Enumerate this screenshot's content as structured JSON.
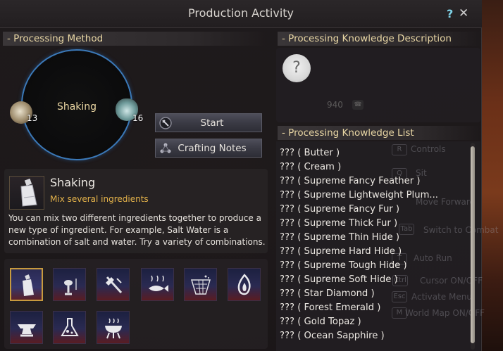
{
  "window": {
    "title": "Production Activity",
    "help": "?",
    "close": "✕"
  },
  "method_section": {
    "header": "- Processing Method",
    "circle_label": "Shaking",
    "ingredient_left_count": "13",
    "ingredient_right_count": "16",
    "start_label": "Start",
    "notes_label": "Crafting Notes"
  },
  "method_info": {
    "name": "Shaking",
    "subtitle": "Mix several ingredients",
    "description": "You can mix two different ingredients together to produce a new type of ingredient. For example, Salt Water is a combination of salt and water. Try a variety of combinations."
  },
  "tools": [
    {
      "name": "shaking",
      "icon": "bottle-icon",
      "selected": true
    },
    {
      "name": "grinding",
      "icon": "mortar-icon",
      "selected": false
    },
    {
      "name": "chopping",
      "icon": "axe-icon",
      "selected": false
    },
    {
      "name": "drying",
      "icon": "fish-icon",
      "selected": false
    },
    {
      "name": "filtering",
      "icon": "net-icon",
      "selected": false
    },
    {
      "name": "heating",
      "icon": "flame-icon",
      "selected": false
    },
    {
      "name": "smithing",
      "icon": "anvil-icon",
      "selected": false
    },
    {
      "name": "alchemy",
      "icon": "flask-icon",
      "selected": false
    },
    {
      "name": "cooking",
      "icon": "grill-icon",
      "selected": false
    }
  ],
  "knowledge_description": {
    "header": "- Processing Knowledge Description",
    "placeholder_icon": "?",
    "value": "940"
  },
  "knowledge_list": {
    "header": "- Processing Knowledge List",
    "items": [
      "??? ( Butter )",
      "??? ( Cream )",
      "??? ( Supreme Fancy Feather )",
      "??? ( Supreme Lightweight Plum...",
      "??? ( Supreme Fancy Fur )",
      "??? ( Supreme Thick Fur )",
      "??? ( Supreme Thin Hide )",
      "??? ( Supreme Hard Hide )",
      "??? ( Supreme Tough Hide )",
      "??? ( Supreme Soft Hide )",
      "??? ( Star Diamond )",
      "??? ( Forest Emerald )",
      "??? ( Gold Topaz )",
      "??? ( Ocean Sapphire )"
    ]
  },
  "overlay_hints": [
    {
      "key": "R",
      "label": "Controls"
    },
    {
      "key": "Q",
      "label": "Sit"
    },
    {
      "key": "",
      "label": "Move Forward"
    },
    {
      "key": "Tab",
      "label": "Switch to Combat"
    },
    {
      "key": "T",
      "label": "Auto Run"
    },
    {
      "key": "Ctrl",
      "label": "Cursor ON/OFF"
    },
    {
      "key": "Esc",
      "label": "Activate Menu"
    },
    {
      "key": "M",
      "label": "World Map ON/OFF"
    }
  ],
  "colors": {
    "accent_gold": "#e3b24a",
    "header_text": "#e8d6a4",
    "circle_border": "#3b79b8"
  }
}
